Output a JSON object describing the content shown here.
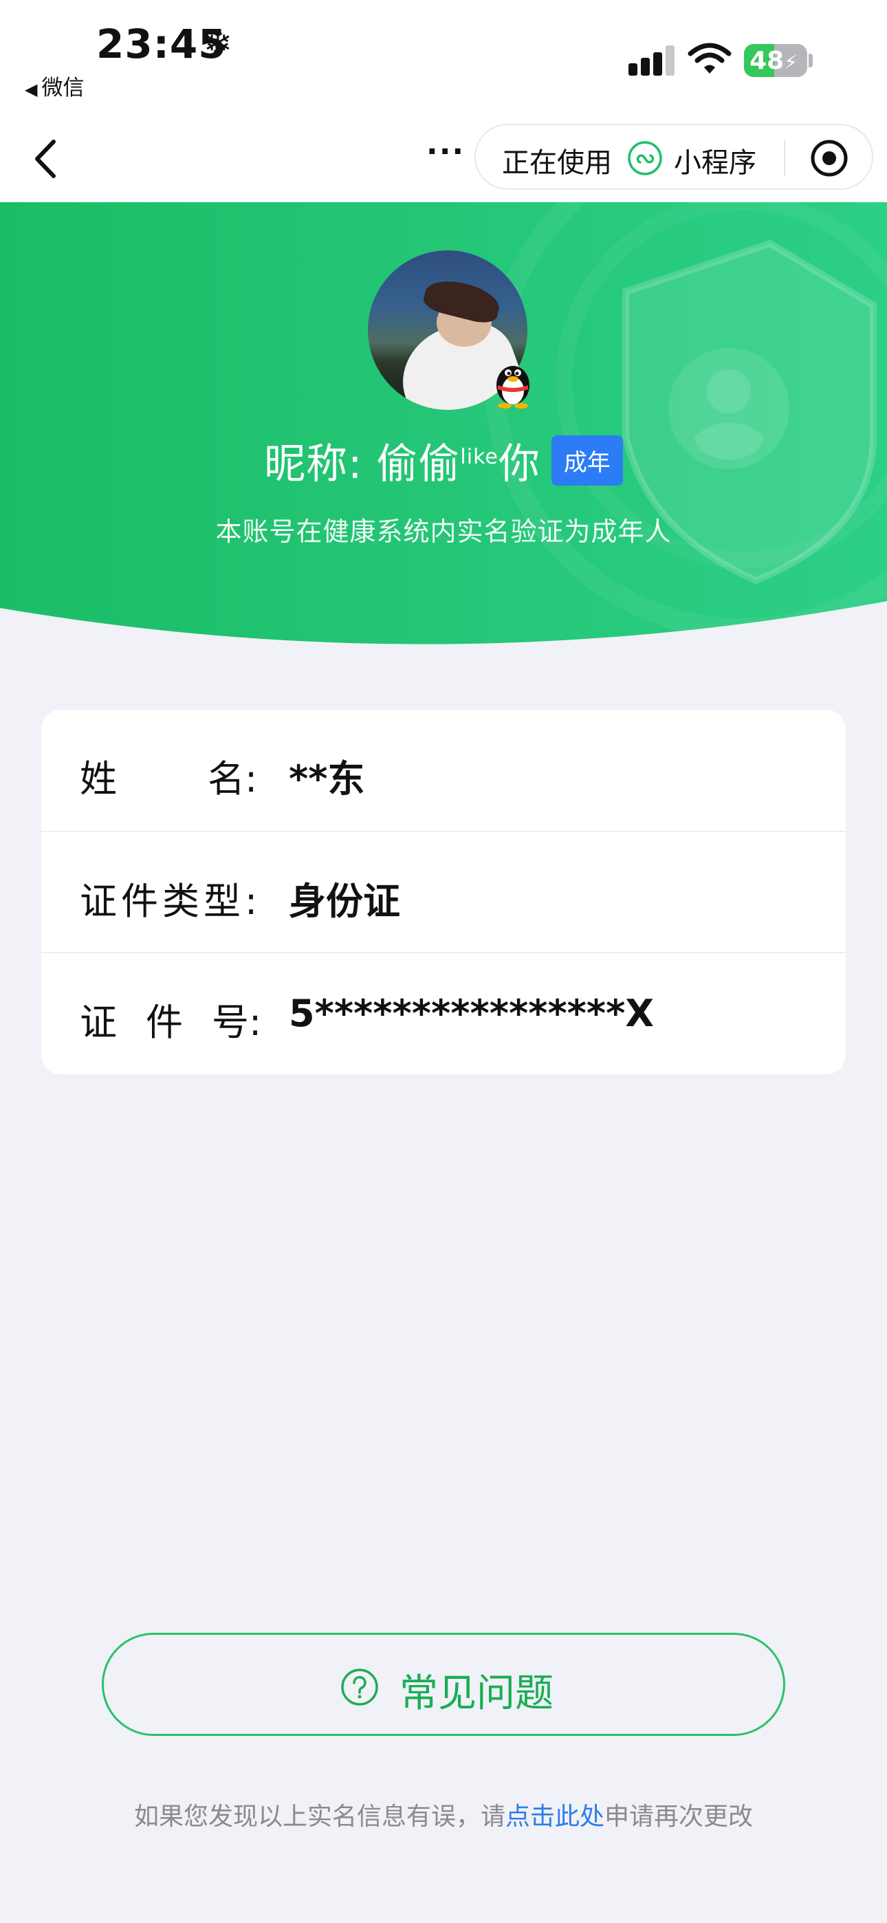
{
  "status_bar": {
    "time": "23:45",
    "back_app_label": "微信",
    "battery_level": "48",
    "battery_fraction": 0.48
  },
  "nav_bar": {
    "more_label": "...",
    "in_use_label": "正在使用",
    "mini_program_label": "小程序"
  },
  "profile": {
    "nickname_prefix": "昵称: 偷偷",
    "nickname_sup": "like",
    "nickname_suffix": "你",
    "adult_badge": "成年",
    "verification_note": "本账号在健康系统内实名验证为成年人"
  },
  "colors": {
    "brand_green": "#1fbe6a",
    "badge_blue": "#2c7cf6",
    "link_blue": "#2f7ce8"
  },
  "info": {
    "name_label_chars": [
      "姓",
      "名:"
    ],
    "name_value": "**东",
    "id_type_label": "证件类型:",
    "id_type_value": "身份证",
    "id_no_label_chars": [
      "证",
      "件",
      "号:"
    ],
    "id_no_value": "5****************X"
  },
  "faq": {
    "label": "常见问题"
  },
  "footer": {
    "text_before": "如果您发现以上实名信息有误，请",
    "link_text": "点击此处",
    "text_after": "申请再次更改"
  }
}
